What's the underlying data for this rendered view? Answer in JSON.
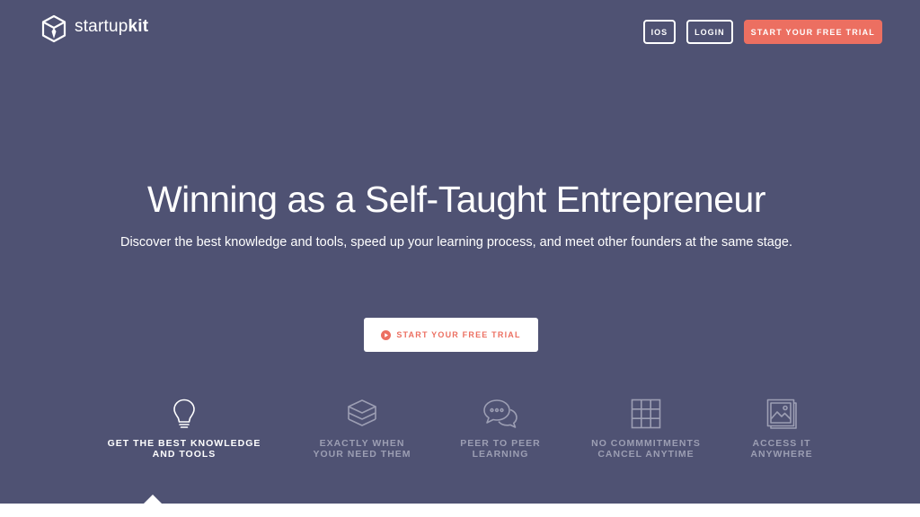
{
  "brand": {
    "name_light": "startup",
    "name_bold": "kit",
    "icon": "cube-icon"
  },
  "nav": {
    "ios_label": "IOS",
    "login_label": "LOGIN",
    "trial_label": "START YOUR FREE TRIAL"
  },
  "hero": {
    "title": "Winning as a Self-Taught Entrepreneur",
    "subtitle": "Discover the best knowledge and tools, speed up your learning process, and meet other founders at the same stage.",
    "cta_label": "START YOUR FREE TRIAL",
    "cta_icon": "play-circle-icon"
  },
  "features": [
    {
      "label": "GET THE BEST KNOWLEDGE\nAND TOOLS",
      "icon": "lightbulb-icon",
      "active": true
    },
    {
      "label": "EXACTLY WHEN\nYOUR NEED THEM",
      "icon": "layers-icon",
      "active": false
    },
    {
      "label": "PEER TO PEER\nLEARNING",
      "icon": "chat-bubbles-icon",
      "active": false
    },
    {
      "label": "NO COMMMITMENTS\nCANCEL ANYTIME",
      "icon": "grid-icon",
      "active": false
    },
    {
      "label": "ACCESS IT\nANYWHERE",
      "icon": "image-stack-icon",
      "active": false
    }
  ],
  "colors": {
    "hero_background": "#4f5273",
    "accent": "#ec6f61",
    "inactive_text": "#9c9eb3"
  }
}
